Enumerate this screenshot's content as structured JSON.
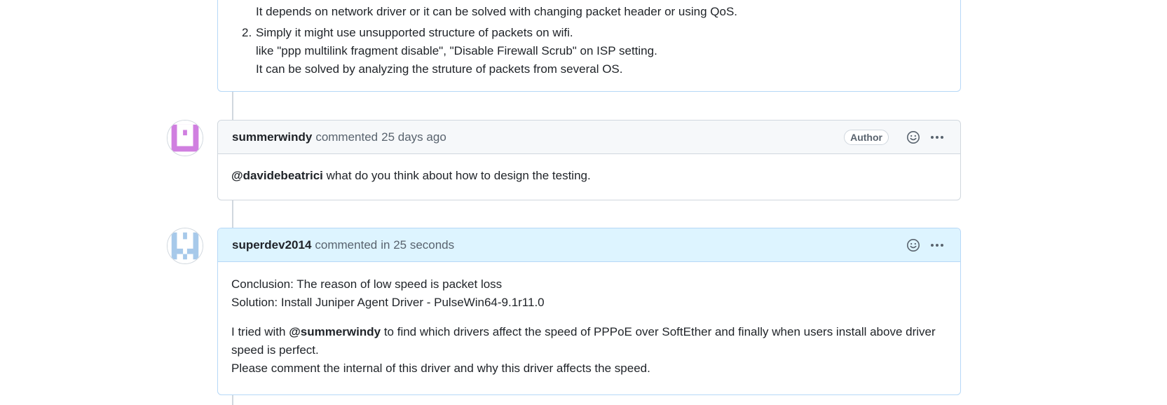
{
  "prev_comment": {
    "list_items": [
      {
        "number": "",
        "lines": [
          "It depends on network driver or it can be solved with changing packet header or using QoS."
        ]
      },
      {
        "number": "2.",
        "lines": [
          "Simply it might use unsupported structure of packets on wifi.",
          "like \"ppp multilink fragment disable\", \"Disable Firewall Scrub\" on ISP setting.",
          "It can be solved by analyzing the struture of packets from several OS."
        ]
      }
    ]
  },
  "comment1": {
    "author": "summerwindy",
    "action": "commented",
    "time": "25 days ago",
    "badge": "Author",
    "body_mention": "@davidebeatrici",
    "body_text": " what do you think about how to design the testing."
  },
  "comment2": {
    "author": "superdev2014",
    "action": "commented",
    "time": "in 25 seconds",
    "para1_line1": "Conclusion: The reason of low speed is packet loss",
    "para1_line2": "Solution: Install Juniper Agent Driver - PulseWin64-9.1r11.0",
    "para2_prefix": "I tried with ",
    "para2_mention": "@summerwindy",
    "para2_suffix": " to find which drivers affect the speed of PPPoE over SoftEther and finally when users install above driver speed is perfect.",
    "para2_line3": "Please comment the internal of this driver and why this driver affects the speed."
  },
  "icons": {
    "reaction": "smiley-icon",
    "menu": "kebab-horizontal-icon"
  },
  "colors": {
    "highlight_header": "#ddf4ff",
    "highlight_border": "#b6d8f7",
    "avatar1": "#d07fe0",
    "avatar2": "#a7c9ea"
  }
}
